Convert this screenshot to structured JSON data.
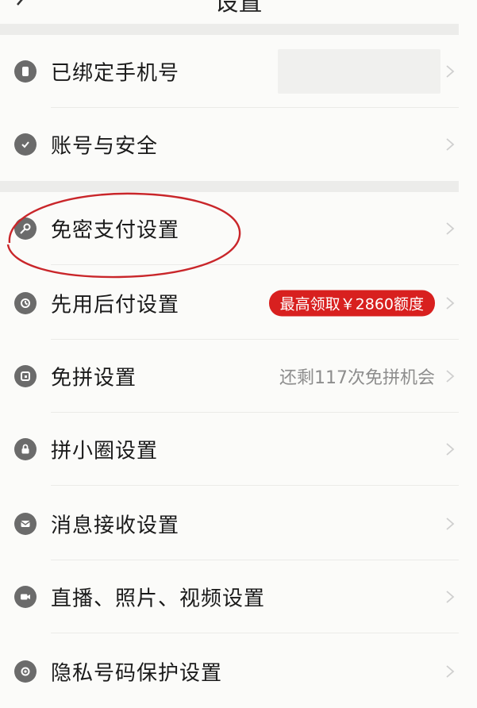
{
  "header": {
    "title": "设置",
    "back_icon": "back-arrow-icon"
  },
  "sections": [
    {
      "items": [
        {
          "label": "已绑定手机号",
          "icon": "phone-icon",
          "value_hidden": true
        },
        {
          "label": "账号与安全",
          "icon": "shield-check-icon"
        }
      ]
    },
    {
      "items": [
        {
          "label": "免密支付设置",
          "icon": "key-icon",
          "highlighted": true
        },
        {
          "label": "先用后付设置",
          "icon": "pay-later-icon",
          "badge": "最高领取￥2860额度"
        },
        {
          "label": "免拼设置",
          "icon": "group-card-icon",
          "right_text": "还剩117次免拼机会"
        },
        {
          "label": "拼小圈设置",
          "icon": "lock-icon"
        },
        {
          "label": "消息接收设置",
          "icon": "message-icon"
        },
        {
          "label": "直播、照片、视频设置",
          "icon": "video-camera-icon"
        },
        {
          "label": "隐私号码保护设置",
          "icon": "privacy-shield-icon"
        }
      ]
    }
  ],
  "colors": {
    "badge_bg": "#d8201f",
    "icon": "#6b6b6b",
    "highlight_oval": "#c9262a"
  }
}
